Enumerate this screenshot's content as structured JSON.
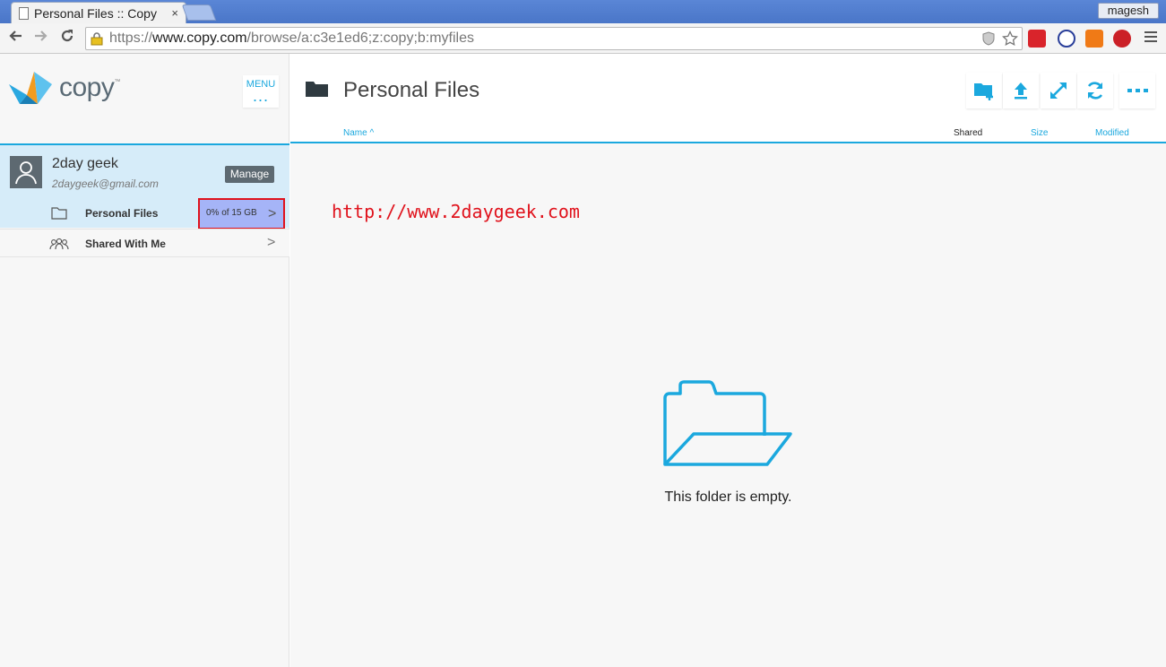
{
  "browser": {
    "tab_title": "Personal Files :: Copy",
    "tab_close": "×",
    "user_badge": "magesh",
    "url_prefix": "https://",
    "url_domain": "www.copy.com",
    "url_path": "/browse/a:c3e1ed6;z:copy;b:myfiles"
  },
  "sidebar": {
    "logo_text": "copy",
    "logo_mark": "™",
    "menu_label": "MENU",
    "menu_dots": "...",
    "account": {
      "name": "2day geek",
      "email": "2daygeek@gmail.com",
      "manage_label": "Manage"
    },
    "items": [
      {
        "label": "Personal Files",
        "quota": "0% of 15 GB",
        "icon": "folder-outline-icon"
      },
      {
        "label": "Shared With Me",
        "icon": "people-icon"
      }
    ]
  },
  "main": {
    "title": "Personal Files",
    "columns": {
      "name": "Name",
      "name_sort": "^",
      "shared": "Shared",
      "size": "Size",
      "modified": "Modified"
    },
    "actions": [
      "new-folder-icon",
      "upload-icon",
      "expand-icon",
      "refresh-icon",
      "more-icon"
    ],
    "watermark": "http://www.2daygeek.com",
    "empty_message": "This folder is empty."
  },
  "colors": {
    "accent": "#1ba8de",
    "selected_bg": "#d6ecf9",
    "quota_highlight": "#a5b4f7",
    "annotation_red": "#e0121c"
  }
}
